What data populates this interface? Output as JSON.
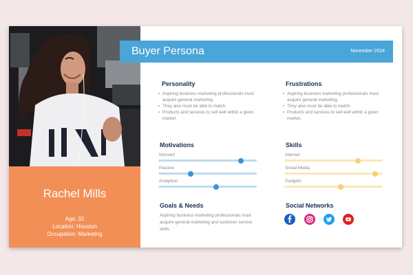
{
  "header": {
    "title": "Buyer Persona",
    "date": "November 2024"
  },
  "profile": {
    "name": "Rachel Mills",
    "age": "Age: 32",
    "location": "Location: Houston",
    "occupation": "Occupation: Marketing"
  },
  "personality": {
    "title": "Personality",
    "bullets": [
      "Aspiring business marketing professionals must acquire general marketing.",
      "They also must be able to match.",
      "Products and services to sell well within a given market."
    ]
  },
  "frustrations": {
    "title": "Frustrations",
    "bullets": [
      "Aspiring business marketing professionals must acquire general marketing.",
      "They also must be able to match.",
      "Products and services to sell well within a given market."
    ]
  },
  "motivations": {
    "title": "Motivations",
    "items": [
      {
        "label": "Introvert",
        "value": 0.84
      },
      {
        "label": "Passive",
        "value": 0.33
      },
      {
        "label": "Analytical",
        "value": 0.59
      }
    ],
    "color_track": "#bcdbee",
    "color_knob": "#3b95d3"
  },
  "skills": {
    "title": "Skills",
    "items": [
      {
        "label": "Internet",
        "value": 0.75
      },
      {
        "label": "Social Media",
        "value": 0.92
      },
      {
        "label": "Gadgets",
        "value": 0.57
      }
    ],
    "color_track": "#fbe7b5",
    "color_knob": "#f8d075"
  },
  "goals": {
    "title": "Goals & Needs",
    "text": "Aspiring business marketing professionals must acquire general marketing and customer service skills."
  },
  "social": {
    "title": "Social Networks",
    "icons": [
      "facebook-icon",
      "instagram-icon",
      "twitter-icon",
      "youtube-icon"
    ]
  },
  "colors": {
    "accent_blue": "#4aa5d8",
    "accent_orange": "#f28f56",
    "heading": "#1e2f57",
    "background": "#f3e7e7"
  }
}
